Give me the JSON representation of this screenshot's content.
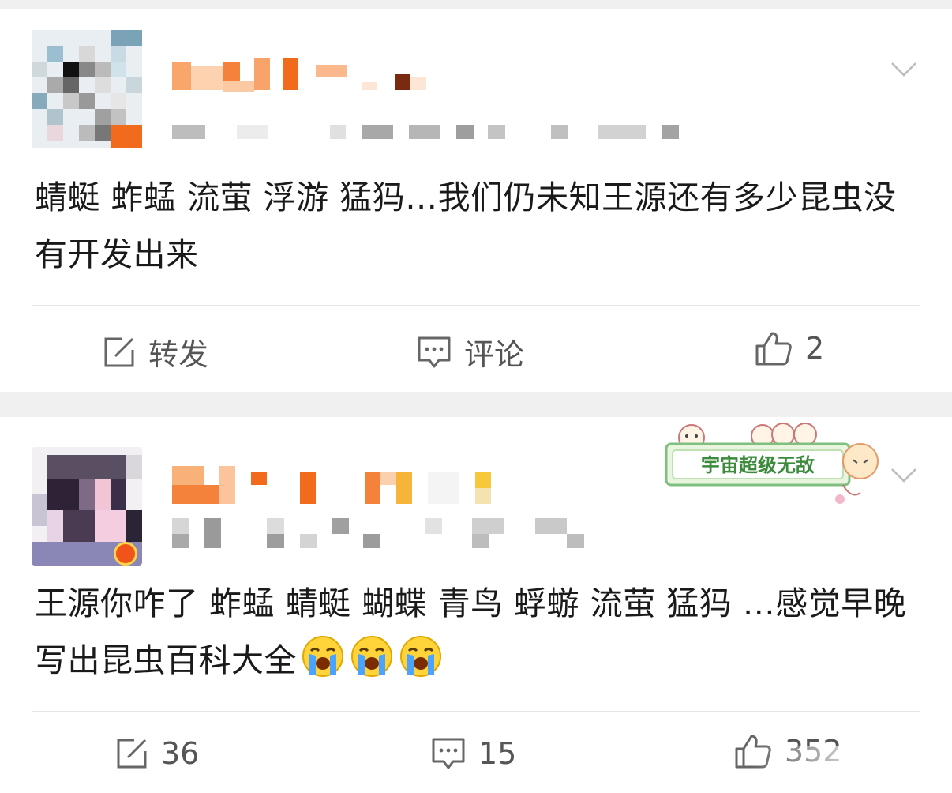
{
  "posts": [
    {
      "text": "蜻蜓 蚱蜢 流萤 浮游 猛犸…我们仍未知王源还有多少昆虫没有开发出来",
      "repost_label": "转发",
      "comment_label": "评论",
      "like_count": "2",
      "avatar_icon": "pixelated-avatar",
      "more_icon": "chevron-down-icon"
    },
    {
      "text": "王源你咋了  蚱蜢 蜻蜓 蝴蝶 青鸟 蜉蝣 流萤 猛犸 …感觉早晚写出昆虫百科大全",
      "emoji_icon": "crying-face-emoji",
      "badge_text": "宇宙超级无敌",
      "repost_count": "36",
      "comment_count": "15",
      "like_count": "352",
      "avatar_icon": "pixelated-avatar",
      "more_icon": "chevron-down-icon"
    }
  ],
  "colors": {
    "page_bg": "#f0f0f0",
    "card_bg": "#ffffff",
    "text": "#1a1a1a",
    "action_text": "#555555",
    "username_orange": "#f5823a",
    "badge_green": "#3c8a3c"
  }
}
